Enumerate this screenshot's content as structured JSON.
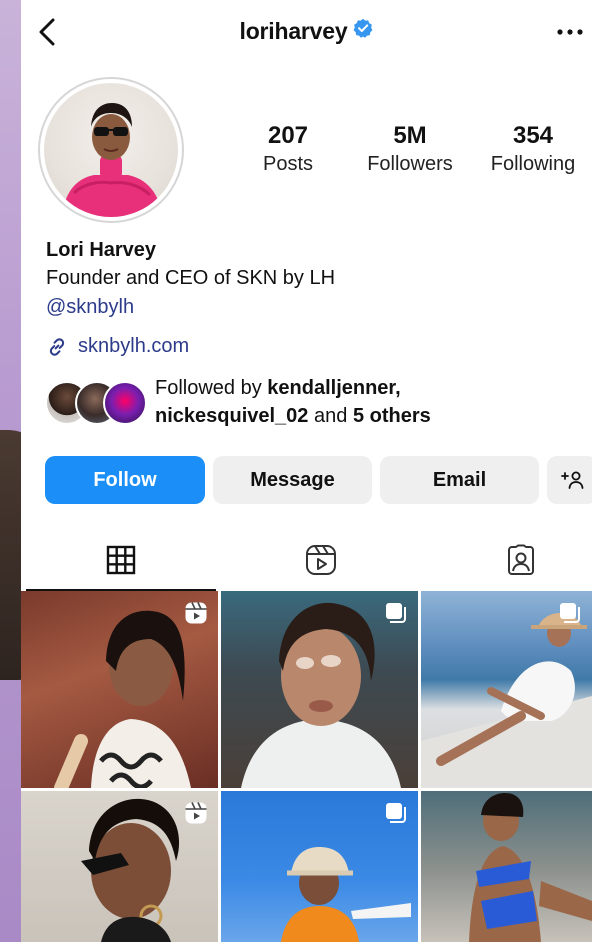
{
  "header": {
    "username": "loriharvey",
    "verified": true
  },
  "stats": [
    {
      "value": "207",
      "label": "Posts"
    },
    {
      "value": "5M",
      "label": "Followers"
    },
    {
      "value": "354",
      "label": "Following"
    }
  ],
  "bio": {
    "name": "Lori Harvey",
    "description": "Founder and CEO of SKN by LH",
    "mention": "@sknbylh",
    "link": "sknbylh.com"
  },
  "followed_by": {
    "prefix": "Followed by",
    "user1": "kendalljenner",
    "separator": ",",
    "user2": "nickesquivel_02",
    "and": "and",
    "others": "5 others"
  },
  "actions": {
    "follow": "Follow",
    "message": "Message",
    "email": "Email"
  },
  "tabs": [
    "posts-grid",
    "reels",
    "tagged"
  ],
  "posts": [
    {
      "type": "reel",
      "icon": "reel-icon"
    },
    {
      "type": "carousel",
      "icon": "carousel-icon"
    },
    {
      "type": "carousel",
      "icon": "carousel-icon"
    },
    {
      "type": "reel",
      "icon": "reel-icon"
    },
    {
      "type": "carousel",
      "icon": "carousel-icon"
    },
    {
      "type": "photo",
      "icon": ""
    }
  ],
  "colors": {
    "accent": "#1b8ff7",
    "link": "#2c3b8a",
    "verified": "#3797f0",
    "button_grey": "#efefef"
  }
}
